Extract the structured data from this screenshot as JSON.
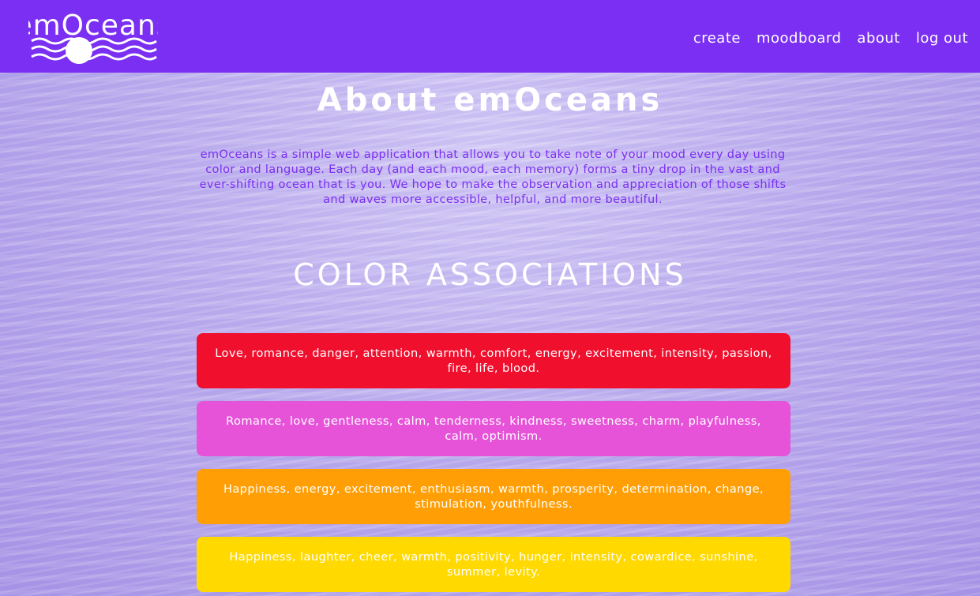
{
  "app": {
    "brand_name": "emOceans"
  },
  "nav": {
    "links": [
      {
        "label": "create"
      },
      {
        "label": "moodboard"
      },
      {
        "label": "about"
      },
      {
        "label": "log out"
      }
    ]
  },
  "about": {
    "title": "About emOceans",
    "description": "emOceans is a simple web application that allows you to take note of your mood every day using color and language. Each day (and each mood, each memory) forms a tiny drop in the vast and ever-shifting ocean that is you. We hope to make the observation and appreciation of those shifts and waves more accessible, helpful, and more beautiful."
  },
  "colors_section": {
    "title": "COLOR ASSOCIATIONS",
    "items": [
      {
        "color": "#f0102e",
        "text": "Love, romance, danger, attention, warmth, comfort, energy, excitement, intensity, passion, fire, life, blood."
      },
      {
        "color": "#e653d8",
        "text": "Romance, love, gentleness, calm, tenderness, kindness, sweetness, charm, playfulness, calm, optimism."
      },
      {
        "color": "#ff9f05",
        "text": "Happiness, energy, excitement, enthusiasm, warmth, prosperity, determination, change, stimulation, youthfulness."
      },
      {
        "color": "#ffd900",
        "text": "Happiness, laughter, cheer, warmth, positivity, hunger, intensity, cowardice, sunshine, summer, levity."
      }
    ]
  },
  "theme": {
    "accent": "#7b2ff2"
  }
}
